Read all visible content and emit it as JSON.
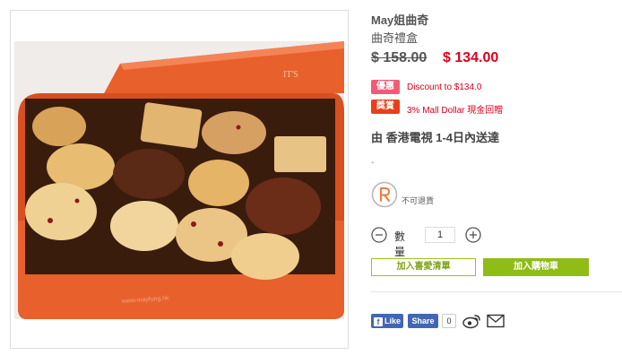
{
  "product": {
    "brand": "May姐曲奇",
    "name": "曲奇禮盒",
    "original_price": "$ 158.00",
    "sale_price": "$ 134.00",
    "image_alt": "May姐曲奇 曲奇禮盒",
    "tin_logo_text": "IT'S",
    "tin_url_text": "www.mayfung.hk"
  },
  "promotions": [
    {
      "badge": "優惠",
      "text": "Discount to $134.0",
      "badge_color": "#f15b78"
    },
    {
      "badge": "獎賞",
      "text": "3% Mall Dollar 現金回贈",
      "badge_color": "#e8401a"
    }
  ],
  "delivery": "由 香港電視 1-4日內送達",
  "dash_text": "-",
  "no_return": {
    "icon": "no-return-icon",
    "label": "不可退貨"
  },
  "quantity": {
    "label": "數量",
    "value": "1"
  },
  "buttons": {
    "wishlist": "加入喜愛清單",
    "cart": "加入購物車"
  },
  "social": {
    "fb_like": "Like",
    "fb_share": "Share",
    "share_count": "0",
    "weibo_icon": "weibo-icon",
    "mail_icon": "mail-icon"
  },
  "colors": {
    "price_red": "#d9001b",
    "accent_green": "#8fbc15",
    "facebook_blue": "#4267b2"
  }
}
